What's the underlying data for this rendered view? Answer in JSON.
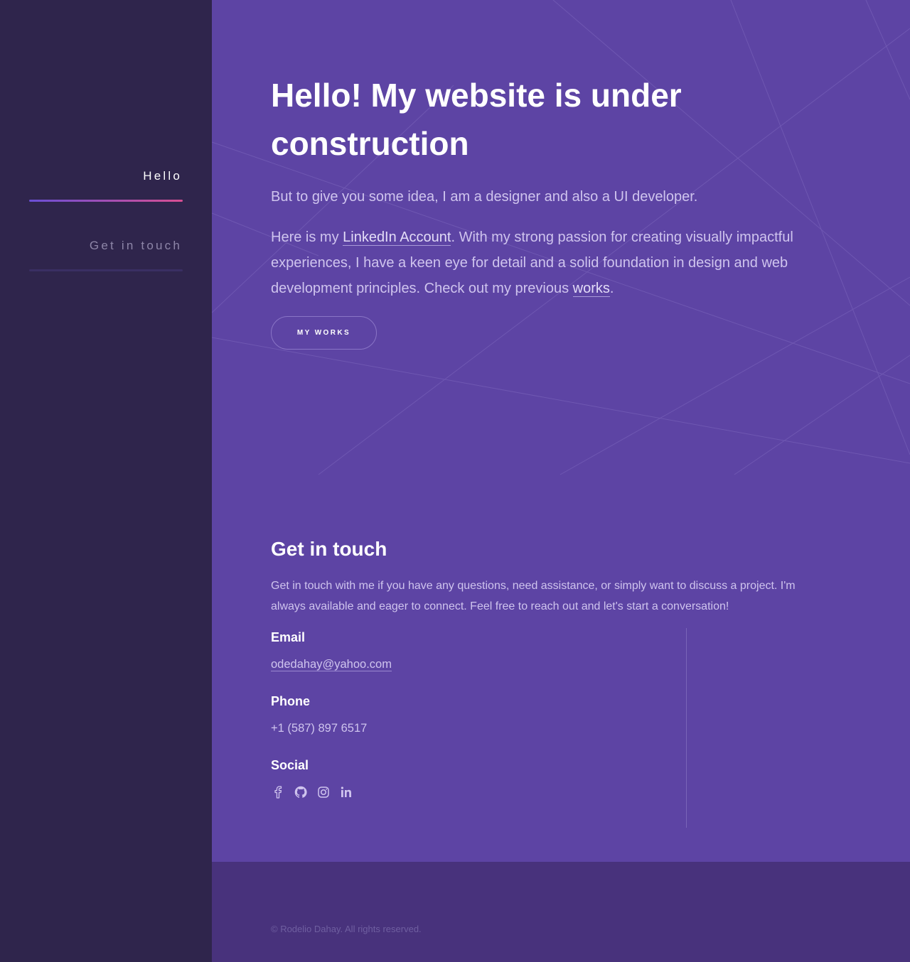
{
  "sidebar": {
    "items": [
      {
        "label": "Hello",
        "active": true
      },
      {
        "label": "Get in touch",
        "active": false
      }
    ]
  },
  "hero": {
    "title": "Hello! My website is under construction",
    "intro": "But to give you some idea, I am a designer and also a UI developer.",
    "bio_prefix": "Here is my ",
    "linkedin_label": "LinkedIn Account",
    "bio_middle": ". With my strong passion for creating visually impactful experiences, I have a keen eye for detail and a solid foundation in design and web development principles. Check out my previous ",
    "works_link_label": "works",
    "bio_suffix": ".",
    "button_label": "MY WORKS"
  },
  "contact": {
    "title": "Get in touch",
    "description": "Get in touch with me if you have any questions, need assistance, or simply want to discuss a project. I'm always available and eager to connect. Feel free to reach out and let's start a conversation!",
    "email_label": "Email",
    "email": "odedahay@yahoo.com",
    "phone_label": "Phone",
    "phone": "+1 (587) 897 6517",
    "social_label": "Social",
    "social_icons": [
      "facebook-icon",
      "github-icon",
      "instagram-icon",
      "linkedin-icon"
    ]
  },
  "footer": {
    "copyright": "© Rodelio Dahay. All rights reserved."
  },
  "colors": {
    "sidebar_bg": "#2f254c",
    "main_bg": "#5d44a4",
    "footer_bg": "#48327c",
    "accent_gradient_start": "#6a4fd6",
    "accent_gradient_end": "#d94f93"
  }
}
